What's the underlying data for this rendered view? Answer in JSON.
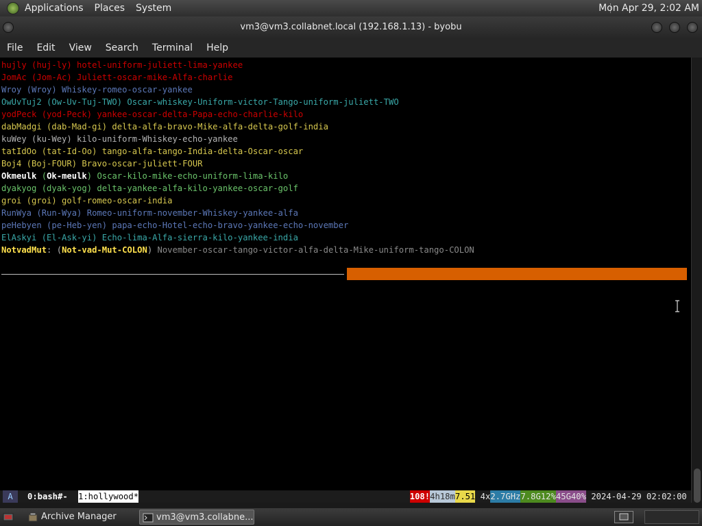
{
  "top_panel": {
    "menus": [
      "Applications",
      "Places",
      "System"
    ],
    "clock": "Mon Apr 29,  2:02 AM"
  },
  "window": {
    "title": "vm3@vm3.collabnet.local (192.168.1.13) - byobu"
  },
  "menubar": [
    "File",
    "Edit",
    "View",
    "Search",
    "Terminal",
    "Help"
  ],
  "terminal": {
    "lines": [
      {
        "text": "hujly (huj-ly) hotel-uniform-juliett-lima-yankee",
        "color": "#cd0000"
      },
      {
        "text": "JomAc (Jom-Ac) Juliett-oscar-mike-Alfa-charlie",
        "color": "#cd0000"
      },
      {
        "text": "Wroy (Wroy) Whiskey-romeo-oscar-yankee",
        "color": "#5c78b8"
      },
      {
        "text": "OwUvTuj2 (Ow-Uv-Tuj-TWO) Oscar-whiskey-Uniform-victor-Tango-uniform-juliett-TWO",
        "color": "#3aa9a9"
      },
      {
        "text": "yodPeck (yod-Peck) yankee-oscar-delta-Papa-echo-charlie-kilo",
        "color": "#cd0000"
      },
      {
        "text": "dabMadgi (dab-Mad-gi) delta-alfa-bravo-Mike-alfa-delta-golf-india",
        "color": "#d7c84f"
      },
      {
        "text": "kuWey (ku-Wey) kilo-uniform-Whiskey-echo-yankee",
        "color": "#b5b5b5"
      },
      {
        "text": "tatIdOo (tat-Id-Oo) tango-alfa-tango-India-delta-Oscar-oscar",
        "color": "#d7c84f"
      },
      {
        "text": "Boj4 (Boj-FOUR) Bravo-oscar-juliett-FOUR",
        "color": "#d7c84f"
      },
      {
        "text": "Okmeulk (Ok-meulk) Oscar-kilo-mike-echo-uniform-lima-kilo",
        "color": "#6bc46b",
        "segments": [
          {
            "text": "Okmeulk",
            "bold": true,
            "color": "#ffffff"
          },
          {
            "text": " (",
            "color": "#6bc46b"
          },
          {
            "text": "Ok-meulk",
            "bold": true,
            "color": "#ffffff"
          },
          {
            "text": ") Oscar-kilo-mike-echo-uniform-lima-kilo",
            "color": "#6bc46b"
          }
        ]
      },
      {
        "text": "dyakyog (dyak-yog) delta-yankee-alfa-kilo-yankee-oscar-golf",
        "color": "#6bc46b"
      },
      {
        "text": "groi (groi) golf-romeo-oscar-india",
        "color": "#d7c84f"
      },
      {
        "text": "RunWya (Run-Wya) Romeo-uniform-november-Whiskey-yankee-alfa",
        "color": "#5c78b8"
      },
      {
        "text": "peHebyen (pe-Heb-yen) papa-echo-Hotel-echo-bravo-yankee-echo-november",
        "color": "#5c78b8"
      },
      {
        "text": "ElAskyi (El-Ask-yi) Echo-lima-Alfa-sierra-kilo-yankee-india",
        "color": "#3aa9a9"
      },
      {
        "text": "NotvadMut: (Not-vad-Mut-COLON) November-oscar-tango-victor-alfa-delta-Mike-uniform-tango-COLON",
        "color": "#8a8a8a",
        "segments": [
          {
            "text": "NotvadMut",
            "bold": true,
            "color": "#ffe14d"
          },
          {
            "text": ": (",
            "color": "#b5b5b5"
          },
          {
            "text": "Not-vad-Mut-COLON",
            "bold": true,
            "color": "#ffe14d"
          },
          {
            "text": ") ",
            "color": "#b5b5b5"
          },
          {
            "text": "November-oscar-tango-victor-alfa-delta-Mike-uniform-tango-COLON",
            "color": "#8a8a8a"
          }
        ]
      }
    ],
    "progress_fraction": 0.5,
    "progress_color": "#d75f00"
  },
  "byobu": {
    "logo": "A",
    "windows": [
      {
        "label": "0:bash#-",
        "active": false
      },
      {
        "label": "1:hollywood*",
        "active": true
      }
    ],
    "stats": [
      {
        "text": "108!",
        "fg": "#ffffff",
        "bg": "#cd0000"
      },
      {
        "text": "4h18m",
        "fg": "#303030",
        "bg": "#b8c8d8"
      },
      {
        "text": "7.51",
        "fg": "#000000",
        "bg": "#e8d84a"
      },
      {
        "text": "4x",
        "fg": "#e5e5e5",
        "bg": "#1c1c1c"
      },
      {
        "text": "2.7GHz",
        "fg": "#e5e5e5",
        "bg": "#2c7ca6"
      },
      {
        "text": "7.8G12%",
        "fg": "#e5e5e5",
        "bg": "#4d8a1f"
      },
      {
        "text": "45G40%",
        "fg": "#e5e5e5",
        "bg": "#8a4d8a"
      },
      {
        "text": "2024-04-29 02:02:00",
        "fg": "#e5e5e5",
        "bg": "#1c1c1c"
      }
    ]
  },
  "taskbar": {
    "tasks": [
      {
        "label": "Archive Manager",
        "icon": "archive-icon",
        "active": false
      },
      {
        "label": "vm3@vm3.collabne...",
        "icon": "terminal-icon",
        "active": true
      }
    ]
  }
}
